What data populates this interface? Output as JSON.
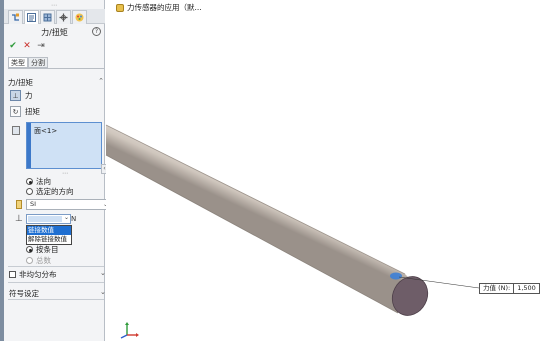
{
  "panel": {
    "tabs": [
      {
        "icon": "feature-manager-icon"
      },
      {
        "icon": "property-manager-icon"
      },
      {
        "icon": "configuration-manager-icon"
      },
      {
        "icon": "dimxpert-icon"
      },
      {
        "icon": "display-manager-icon"
      }
    ],
    "title": "力/扭矩",
    "help_glyph": "?",
    "actions": {
      "ok": "✔",
      "cancel": "✕",
      "pin": "⇥"
    },
    "subtabs": [
      "类型",
      "分割"
    ],
    "group_title": "力/扭矩",
    "force_label": "力",
    "torque_label": "扭矩",
    "selection_item": "面<1>",
    "direction_options": [
      "法向",
      "选定的方向"
    ],
    "unit_value": "SI",
    "force_unit": "N",
    "dropdown_items": [
      "链接数值",
      "解除链接数值"
    ],
    "distribution_options": [
      "按条目",
      "总数"
    ],
    "nonuniform_label": "非均匀分布",
    "symbol_settings": "符号设定"
  },
  "viewport": {
    "tree_item": "力传感器的应用（默..."
  },
  "callout": {
    "label": "力值 (N):",
    "value": "1,500"
  },
  "colors": {
    "selection": "#cfe1f5",
    "accent": "#1f6fd1",
    "cylinder": "#e6dfd7",
    "end_face": "#6e5d68",
    "marker": "#3d7fd6"
  }
}
